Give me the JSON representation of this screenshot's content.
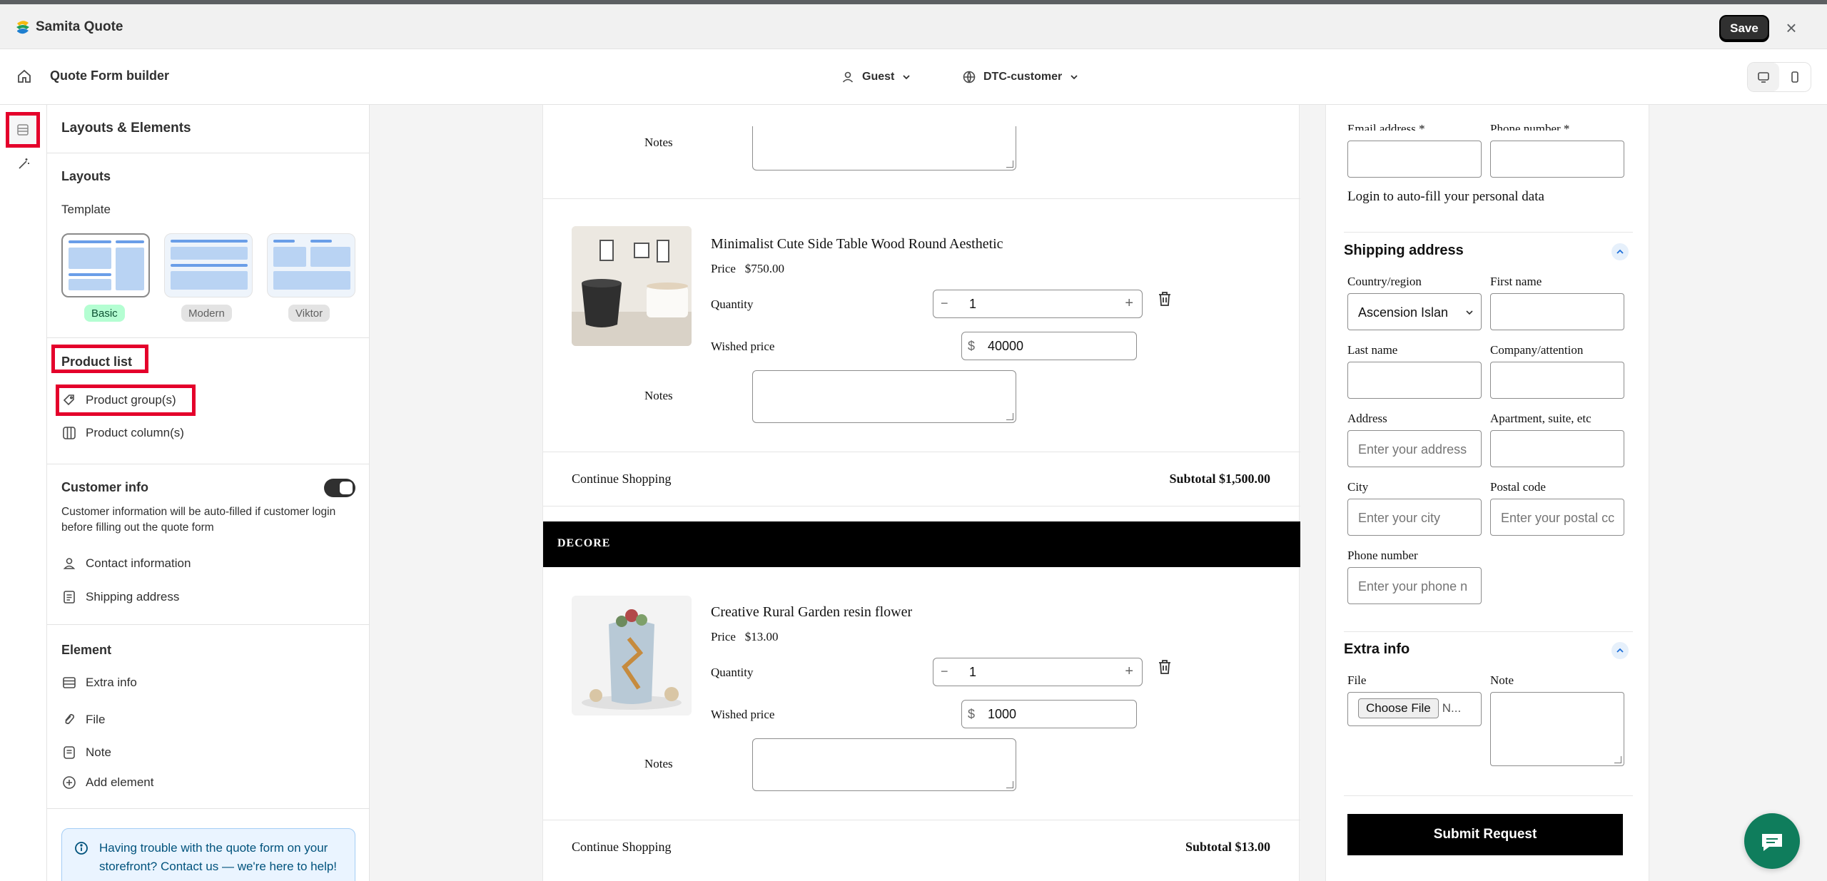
{
  "app": {
    "name": "Samita Quote",
    "save_label": "Save"
  },
  "toolbar": {
    "title": "Quote Form builder",
    "customer_type": "Guest",
    "segment": "DTC-customer"
  },
  "panel": {
    "title": "Layouts & Elements",
    "layouts_title": "Layouts",
    "template_label": "Template",
    "templates": [
      {
        "label": "Basic",
        "selected": true
      },
      {
        "label": "Modern",
        "selected": false
      },
      {
        "label": "Viktor",
        "selected": false
      }
    ],
    "product_list_title": "Product list",
    "product_list_items": [
      "Product group(s)",
      "Product column(s)"
    ],
    "customer_info_title": "Customer info",
    "customer_info_desc": "Customer information will be auto-filled if customer login before filling out the quote form",
    "customer_info_items": [
      "Contact information",
      "Shipping address"
    ],
    "element_title": "Element",
    "element_items": [
      "Extra info",
      "File",
      "Note",
      "Add element"
    ],
    "help_text": "Having trouble with the quote form on your storefront? Contact us — we're here to help!"
  },
  "cart": {
    "notes_label": "Notes",
    "quantity_label": "Quantity",
    "wished_price_label": "Wished price",
    "price_label": "Price",
    "currency": "$",
    "continue_label": "Continue Shopping",
    "group_header": "DECORE",
    "products": [
      {
        "name": "Minimalist Cute Side Table Wood Round Aesthetic",
        "price": "$750.00",
        "quantity": "1",
        "wished_price": "40000"
      },
      {
        "name": "Creative Rural Garden resin flower",
        "price": "$13.00",
        "quantity": "1",
        "wished_price": "1000"
      }
    ],
    "subtotals": [
      "Subtotal $1,500.00",
      "Subtotal $13.00"
    ]
  },
  "form": {
    "email_label": "Email address *",
    "phone_label_top": "Phone number *",
    "login_text": "Login to auto-fill your personal data",
    "shipping_title": "Shipping address",
    "country_label": "Country/region",
    "country_value": "Ascension Islan",
    "first_name_label": "First name",
    "last_name_label": "Last name",
    "company_label": "Company/attention",
    "address_label": "Address",
    "address_placeholder": "Enter your address",
    "apartment_label": "Apartment, suite, etc",
    "city_label": "City",
    "city_placeholder": "Enter your city",
    "postal_label": "Postal code",
    "postal_placeholder": "Enter your postal cc",
    "phone_label": "Phone number",
    "phone_placeholder": "Enter your phone n",
    "extra_title": "Extra info",
    "file_label": "File",
    "file_button": "Choose File",
    "file_status": "N...",
    "note_label": "Note",
    "submit_label": "Submit Request"
  }
}
